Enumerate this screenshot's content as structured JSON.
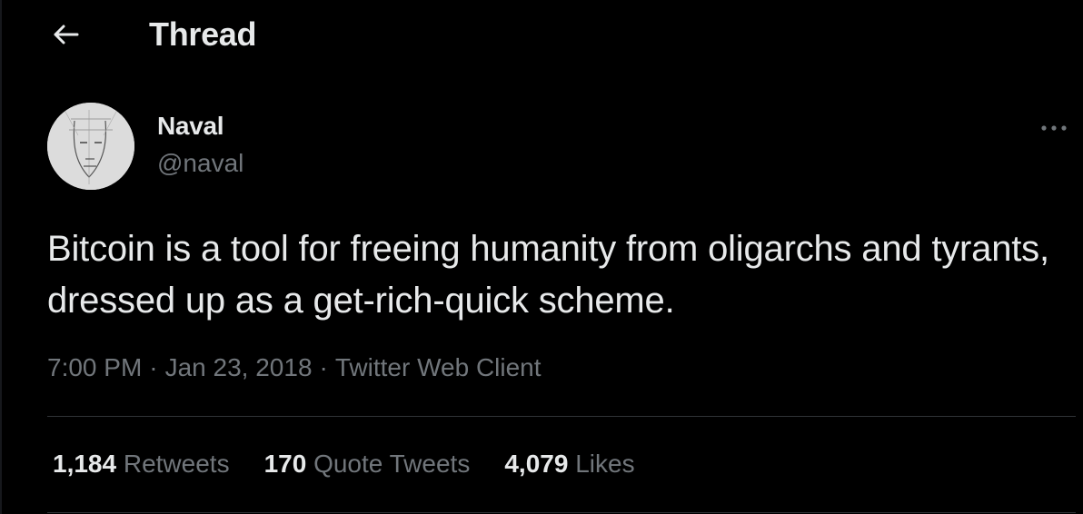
{
  "header": {
    "title": "Thread",
    "back_icon": "arrow-left-icon"
  },
  "tweet": {
    "author": {
      "name": "Naval",
      "handle": "@naval"
    },
    "text": "Bitcoin is a tool for freeing humanity from oligarchs and tyrants, dressed up as a get-rich-quick scheme.",
    "meta": {
      "time": "7:00 PM",
      "date": "Jan 23, 2018",
      "client": "Twitter Web Client",
      "separator": "·"
    },
    "stats": {
      "retweets": {
        "count": "1,184",
        "label": "Retweets"
      },
      "quotes": {
        "count": "170",
        "label": "Quote Tweets"
      },
      "likes": {
        "count": "4,079",
        "label": "Likes"
      }
    }
  },
  "colors": {
    "background": "#000000",
    "primary_text": "#e7e9ea",
    "secondary_text": "#71767b",
    "divider": "#2f3336"
  }
}
